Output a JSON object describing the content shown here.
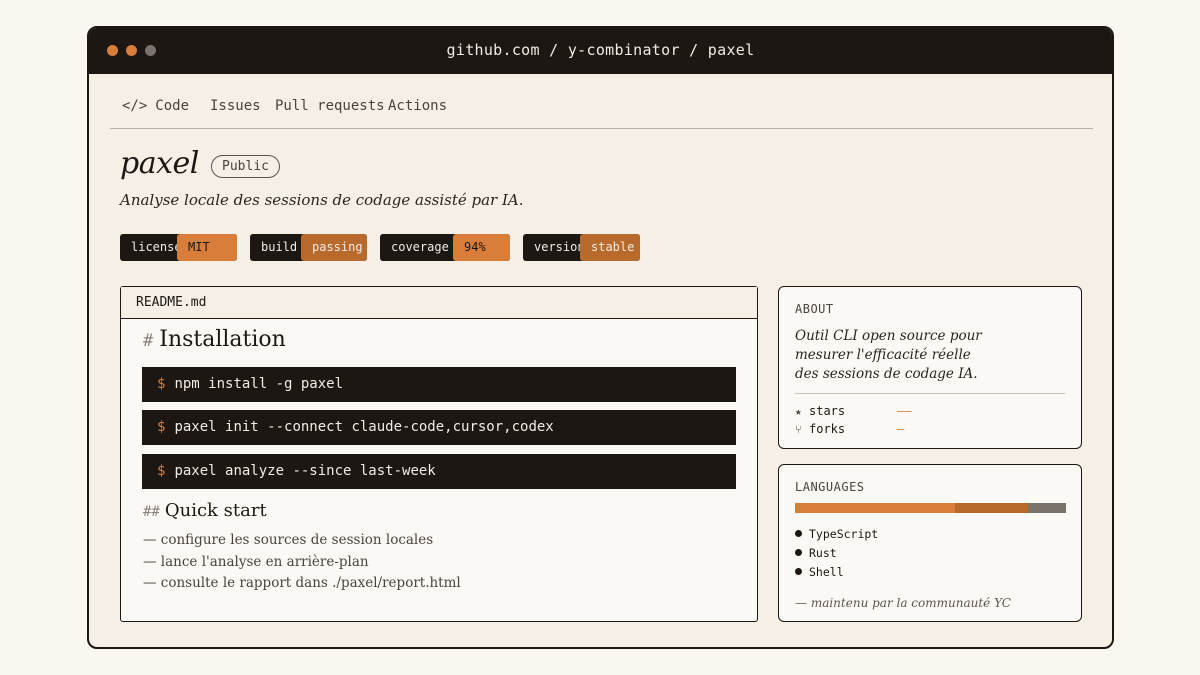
{
  "window": {
    "title": "github.com / y-combinator / paxel"
  },
  "nav": {
    "code_icon": "</>",
    "code": "Code",
    "issues": "Issues",
    "pull_requests": "Pull requests",
    "actions": "Actions"
  },
  "repo": {
    "name": "paxel",
    "visibility": "Public",
    "description": "Analyse locale des sessions de codage assisté par IA."
  },
  "badges": [
    {
      "label": "license",
      "value": "MIT"
    },
    {
      "label": "build",
      "value": "passing"
    },
    {
      "label": "coverage",
      "value": "94%"
    },
    {
      "label": "version",
      "value": "stable"
    }
  ],
  "readme": {
    "filename": "README.md",
    "h1_hash": "#",
    "h1": "Installation",
    "prompt": "$",
    "commands": [
      "npm install -g paxel",
      "paxel init --connect claude-code,cursor,codex",
      "paxel analyze --since last-week"
    ],
    "h2_hash": "##",
    "h2": "Quick start",
    "items": [
      "— configure les sources de session locales",
      "— lance l'analyse en arrière-plan",
      "— consulte le rapport dans ./paxel/report.html"
    ]
  },
  "about": {
    "title": "ABOUT",
    "lines": [
      "Outil CLI open source pour",
      "mesurer l'efficacité réelle",
      "des sessions de codage IA."
    ],
    "stars_icon": "★",
    "stars_label": "stars",
    "stars_value": "——",
    "forks_icon": "⑂",
    "forks_label": "forks",
    "forks_value": "—"
  },
  "languages": {
    "title": "LANGUAGES",
    "items": [
      {
        "name": "TypeScript",
        "share": 0.59,
        "color": "#d97e3a"
      },
      {
        "name": "Rust",
        "share": 0.27,
        "color": "#b8692c"
      },
      {
        "name": "Shell",
        "share": 0.14,
        "color": "#7a736b"
      }
    ],
    "maintained": "— maintenu par la communauté YC"
  }
}
